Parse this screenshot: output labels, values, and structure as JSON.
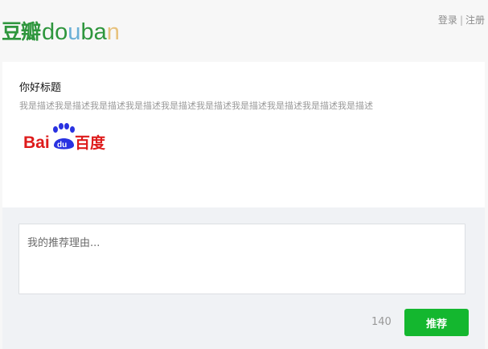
{
  "header": {
    "logo_cn": "豆瓣",
    "logo_en_letters": [
      "d",
      "o",
      "u",
      "b",
      "a",
      "n"
    ],
    "login_label": "登录",
    "separator": "|",
    "register_label": "注册"
  },
  "share_card": {
    "title": "你好标题",
    "description": "我是描述我是描述我是描述我是描述我是描述我是描述我是描述我是描述我是描述我是描述",
    "image_logo": {
      "text_left": "Bai",
      "text_badge": "du",
      "text_right": "百度"
    }
  },
  "compose": {
    "reason_placeholder": "我的推荐理由...",
    "reason_value": "",
    "char_count": "140",
    "submit_label": "推荐"
  },
  "colors": {
    "brand_green": "#2e963d",
    "submit_green": "#14b72f",
    "baidu_red": "#de1b1b",
    "baidu_blue": "#2932e1"
  }
}
